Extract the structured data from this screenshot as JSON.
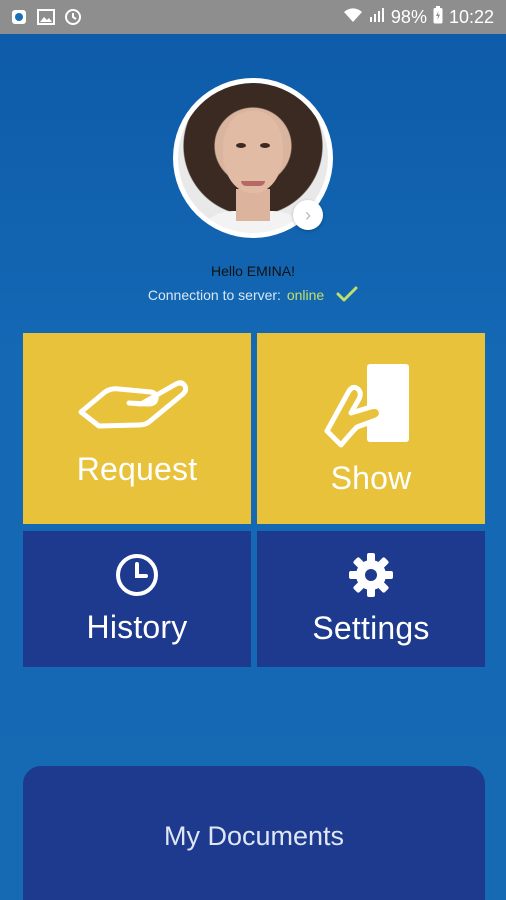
{
  "status_bar": {
    "battery": "98%",
    "time": "10:22",
    "icons": [
      "app-notification-icon",
      "image-icon",
      "sync-icon",
      "wifi-icon",
      "signal-icon",
      "battery-charging-icon"
    ]
  },
  "profile": {
    "greeting": "Hello EMINA!",
    "connection_label": "Connection to server:",
    "connection_status": "online",
    "status_color": "#bfe06a"
  },
  "tiles": {
    "request": {
      "label": "Request",
      "icon": "hand-icon",
      "color": "#e8c23b"
    },
    "show": {
      "label": "Show",
      "icon": "hand-card-icon",
      "color": "#e8c23b"
    },
    "history": {
      "label": "History",
      "icon": "clock-icon",
      "color": "#1d3a8e"
    },
    "settings": {
      "label": "Settings",
      "icon": "gear-icon",
      "color": "#1d3a8e"
    }
  },
  "documents": {
    "label": "My Documents"
  }
}
